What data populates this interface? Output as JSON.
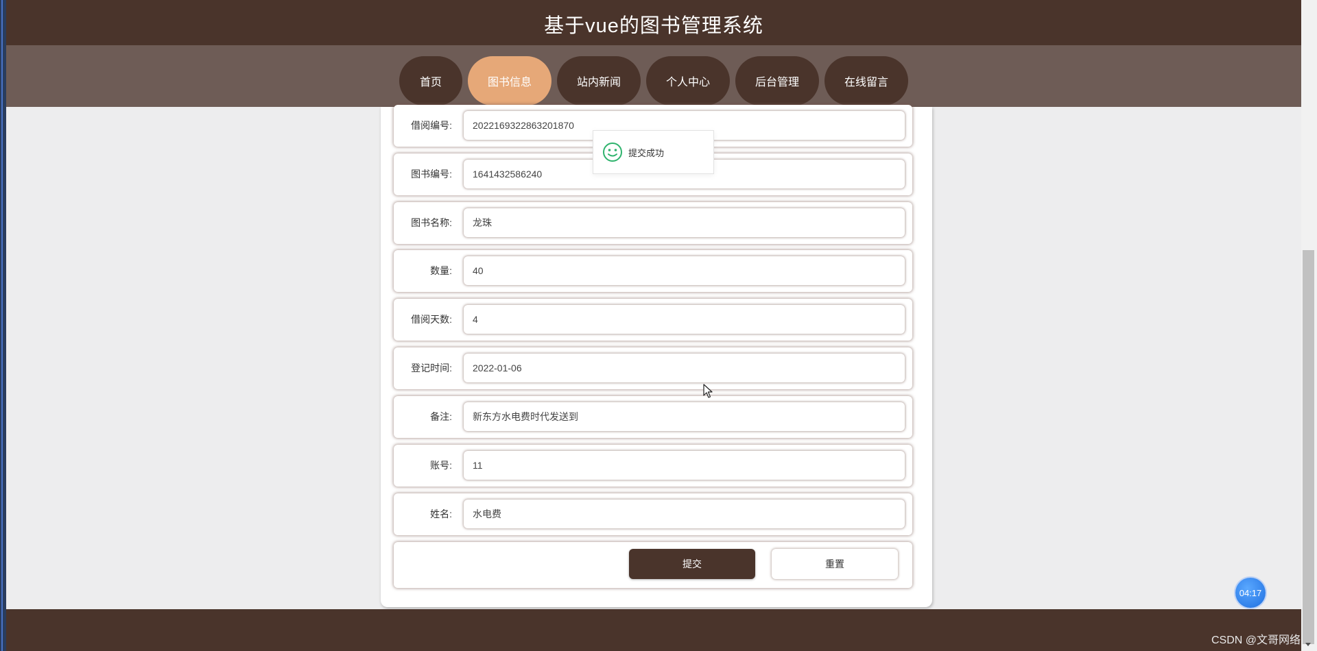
{
  "header": {
    "title": "基于vue的图书管理系统"
  },
  "nav": {
    "items": [
      {
        "label": "首页",
        "active": false
      },
      {
        "label": "图书信息",
        "active": true
      },
      {
        "label": "站内新闻",
        "active": false
      },
      {
        "label": "个人中心",
        "active": false
      },
      {
        "label": "后台管理",
        "active": false
      },
      {
        "label": "在线留言",
        "active": false
      }
    ]
  },
  "form": {
    "fields": [
      {
        "label": "借阅编号:",
        "value": "2022169322863201870"
      },
      {
        "label": "图书编号:",
        "value": "1641432586240"
      },
      {
        "label": "图书名称:",
        "value": "龙珠"
      },
      {
        "label": "数量:",
        "value": "40"
      },
      {
        "label": "借阅天数:",
        "value": "4"
      },
      {
        "label": "登记时间:",
        "value": "2022-01-06"
      },
      {
        "label": "备注:",
        "value": "新东方水电费时代发送到"
      },
      {
        "label": "账号:",
        "value": "11"
      },
      {
        "label": "姓名:",
        "value": "水电费"
      }
    ],
    "submit_label": "提交",
    "reset_label": "重置"
  },
  "toast": {
    "text": "提交成功",
    "icon": "smile-icon"
  },
  "timer": {
    "text": "04:17"
  },
  "watermark": {
    "text": "CSDN @文哥网络"
  },
  "colors": {
    "header_bg": "#4a342b",
    "nav_bg": "#6e5c56",
    "nav_active": "#e6a878",
    "page_bg": "#ededee",
    "success": "#2fb36d"
  }
}
